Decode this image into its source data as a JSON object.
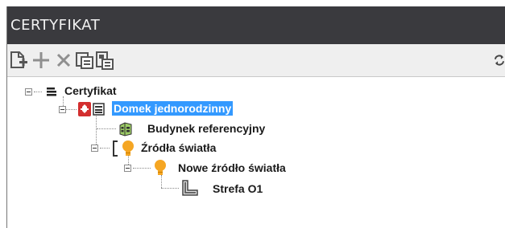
{
  "window": {
    "title": "CERTYFIKAT"
  },
  "toolbar": {
    "icons": [
      "new-document-icon",
      "add-icon",
      "delete-icon",
      "copy-icon",
      "paste-icon",
      "refresh-icon"
    ]
  },
  "tree": {
    "root": {
      "label": "Certyfikat",
      "icon": "list-icon"
    },
    "house": {
      "label": "Domek jednorodzinny",
      "icon": "poland-emblem-icon"
    },
    "reference_building": {
      "label": "Budynek referencyjny",
      "icon": "building-icon"
    },
    "light_sources": {
      "label": "Źródła światła",
      "icon": "lightbulb-icon"
    },
    "new_light_source": {
      "label": "Nowe źródło światła",
      "icon": "lightbulb-icon"
    },
    "zone": {
      "label": "Strefa O1",
      "icon": "zone-icon"
    }
  },
  "colors": {
    "titlebar": "#3a3a3e",
    "selection": "#3399ff",
    "bulb": "#f5a623"
  }
}
